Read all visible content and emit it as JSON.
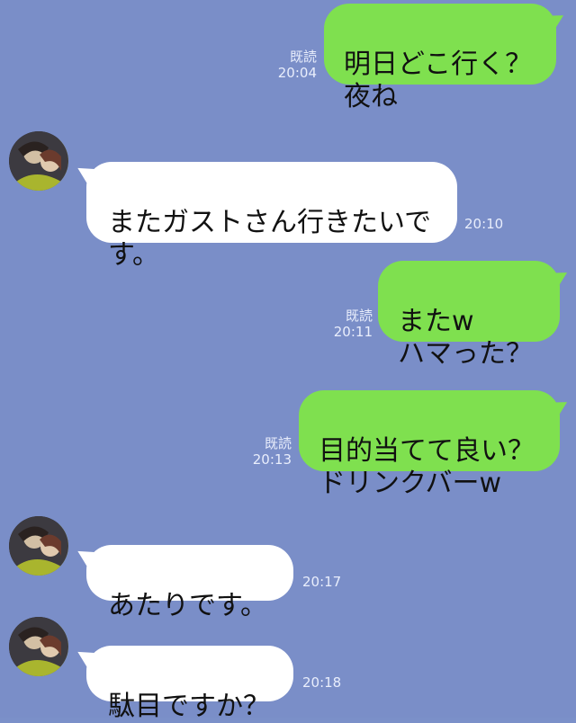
{
  "messages": [
    {
      "id": "m1",
      "direction": "sent",
      "text": "明日どこ行く？\n夜ね",
      "read": "既読",
      "time": "20:04"
    },
    {
      "id": "m2",
      "direction": "received",
      "text": "またガストさん行きたいで\nす。",
      "time": "20:10"
    },
    {
      "id": "m3",
      "direction": "sent",
      "text": "またw\nハマった？",
      "read": "既読",
      "time": "20:11"
    },
    {
      "id": "m4",
      "direction": "sent",
      "text": "目的当てて良い？\nドリンクバーw",
      "read": "既読",
      "time": "20:13"
    },
    {
      "id": "m5",
      "direction": "received",
      "text": "あたりです。",
      "time": "20:17"
    },
    {
      "id": "m6",
      "direction": "received",
      "text": "駄目ですか？",
      "time": "20:18"
    }
  ],
  "colors": {
    "background": "#7a8ec8",
    "sent_bubble": "#7fe04f",
    "received_bubble": "#ffffff",
    "meta_text": "#e9eefc"
  },
  "icons": {
    "avatar": "contact-avatar-photo"
  }
}
